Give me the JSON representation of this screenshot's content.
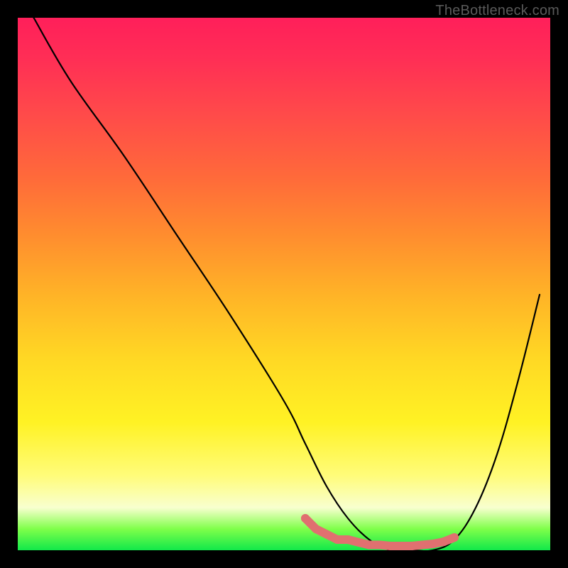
{
  "watermark": "TheBottleneck.com",
  "chart_data": {
    "type": "line",
    "title": "",
    "xlabel": "",
    "ylabel": "",
    "xlim": [
      0,
      100
    ],
    "ylim": [
      0,
      100
    ],
    "series": [
      {
        "name": "bottleneck-curve",
        "x": [
          3,
          10,
          20,
          30,
          40,
          50,
          54,
          58,
          62,
          66,
          70,
          74,
          78,
          82,
          86,
          90,
          94,
          98
        ],
        "values": [
          100,
          88,
          74,
          59,
          44,
          28,
          20,
          12,
          6,
          2,
          0,
          0,
          0,
          2,
          8,
          18,
          32,
          48
        ]
      }
    ],
    "markers": {
      "name": "highlight-band",
      "color": "#e07070",
      "x": [
        54,
        56,
        58,
        60,
        62,
        64,
        66,
        68,
        70,
        72,
        74,
        76,
        78,
        80,
        82
      ],
      "values": [
        6,
        4,
        3,
        2,
        2,
        1.5,
        1,
        1,
        0.8,
        0.8,
        0.8,
        1,
        1.2,
        1.6,
        2.4
      ]
    }
  }
}
